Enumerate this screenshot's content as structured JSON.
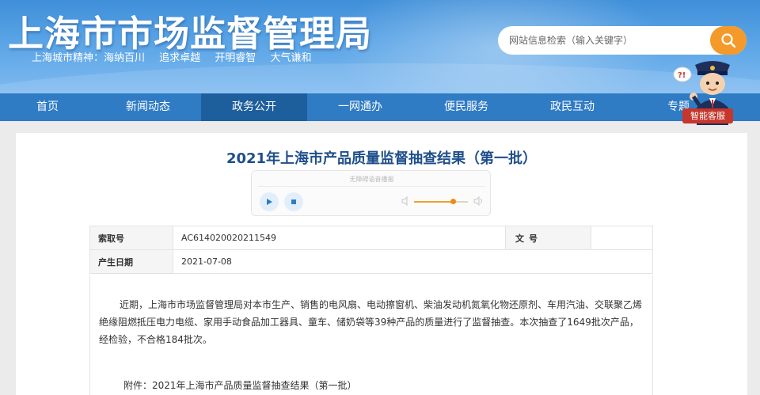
{
  "header": {
    "site_title": "上海市市场监督管理局",
    "slogan": [
      "上海城市精神：海纳百川",
      "追求卓越",
      "开明睿智",
      "大气谦和"
    ],
    "search_placeholder": "网站信息检索（输入关键字）",
    "search_icon": "search-icon"
  },
  "nav": {
    "items": [
      {
        "label": "首页",
        "active": false
      },
      {
        "label": "新闻动态",
        "active": false
      },
      {
        "label": "政务公开",
        "active": true
      },
      {
        "label": "一网通办",
        "active": false
      },
      {
        "label": "便民服务",
        "active": false
      },
      {
        "label": "政民互动",
        "active": false
      },
      {
        "label": "专题",
        "active": false
      }
    ]
  },
  "assistant": {
    "label": "智能客服",
    "bubble": "?!"
  },
  "article": {
    "title": "2021年上海市产品质量监督抽查结果（第一批）",
    "player": {
      "caption": "无障碍语音播报",
      "play_icon": "play-icon",
      "stop_icon": "stop-icon",
      "volume": 0.72
    },
    "meta": {
      "index_label": "索取号",
      "index_value": "AC614020020211549",
      "doc_no_label": "文号",
      "doc_no_value": "",
      "date_label": "产生日期",
      "date_value": "2021-07-08"
    },
    "paragraph": "近期，上海市市场监督管理局对本市生产、销售的电风扇、电动擦窗机、柴油发动机氮氧化物还原剂、车用汽油、交联聚乙烯绝缘阻燃抵压电力电缆、家用手动食品加工器具、童车、储奶袋等39种产品的质量进行了监督抽查。本次抽查了1649批次产品，经检验，不合格184批次。",
    "attachment_prefix": "附件：",
    "attachment_link": "2021年上海市产品质量监督抽查结果（第一批）"
  },
  "colors": {
    "nav_bg": "#2f7bc4",
    "nav_active": "#1d5e9c",
    "title": "#1f4f8a",
    "search_button": "#f39a2b",
    "assistant_label": "#c6362c"
  }
}
